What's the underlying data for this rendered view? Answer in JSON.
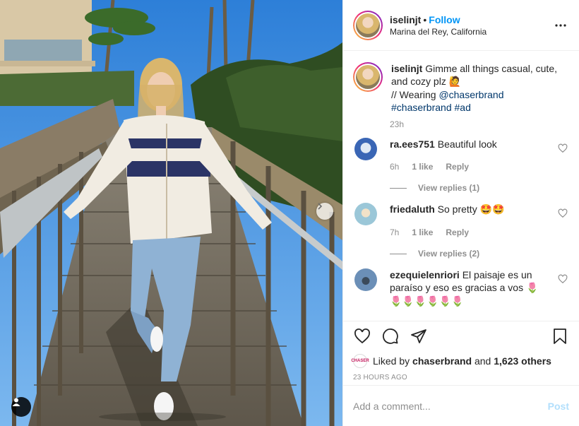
{
  "post": {
    "username": "iselinjt",
    "separator": "•",
    "follow_label": "Follow",
    "location": "Marina del Rey, California",
    "more_icon": "more-horizontal-icon"
  },
  "caption": {
    "username": "iselinjt",
    "text_1": "Gimme all things casual, cute, and cozy plz",
    "emoji_1": "🙋",
    "text_2": "// Wearing",
    "mention": "@chaserbrand",
    "hashtag_1": "#chaserbrand",
    "hashtag_2": "#ad",
    "time": "23h"
  },
  "comments": [
    {
      "username": "ra.ees751",
      "text": "Beautiful look",
      "time": "6h",
      "likes": "1 like",
      "reply_label": "Reply",
      "view_replies": "View replies (1)",
      "avatar_color": "#3a66b5"
    },
    {
      "username": "friedaluth",
      "text": "So pretty",
      "emoji": "🤩🤩",
      "time": "7h",
      "likes": "1 like",
      "reply_label": "Reply",
      "view_replies": "View replies (2)",
      "avatar_color": "#9bc7d8"
    },
    {
      "username": "ezequielenriori",
      "text": "El paisaje es un paraíso y eso es gracias a vos",
      "emoji": "🌷",
      "emoji_line": "🌷🌷🌷🌷🌷🌷",
      "avatar_color": "#6b8fb7"
    }
  ],
  "actions": {
    "like_icon": "heart-icon",
    "comment_icon": "comment-icon",
    "share_icon": "share-icon",
    "save_icon": "bookmark-icon"
  },
  "likes": {
    "prefix": "Liked by",
    "user": "chaserbrand",
    "and": "and",
    "others": "1,623 others",
    "avatar_text": "CHASER"
  },
  "timestamp": "23 HOURS AGO",
  "add_comment": {
    "placeholder": "Add a comment...",
    "post_label": "Post"
  },
  "colors": {
    "follow_blue": "#0095f6",
    "link_blue": "#00376b",
    "muted": "#8e8e8e",
    "post_disabled": "#b2dffc"
  }
}
